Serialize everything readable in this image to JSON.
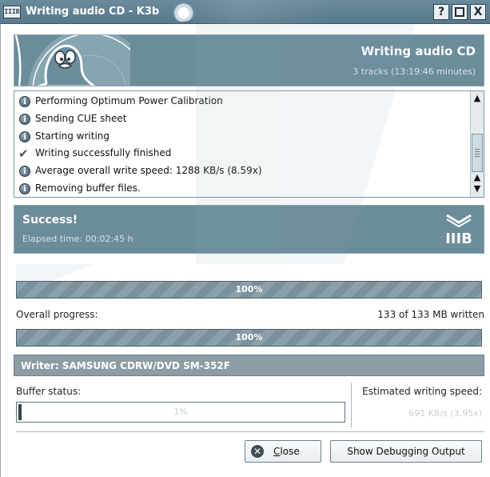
{
  "window": {
    "title": "Writing audio CD - K3b",
    "app_icon_text": "IIIB",
    "help_button": "?",
    "maximize_button": "□",
    "close_button": "X"
  },
  "header": {
    "title": "Writing audio CD",
    "subtitle": "3 tracks (13:19:46 minutes)"
  },
  "log": {
    "items": [
      {
        "icon": "info-icon",
        "text": "Performing Optimum Power Calibration"
      },
      {
        "icon": "info-icon",
        "text": "Sending CUE sheet"
      },
      {
        "icon": "info-icon",
        "text": "Starting writing"
      },
      {
        "icon": "check-icon",
        "text": "Writing successfully finished"
      },
      {
        "icon": "info-icon",
        "text": "Average overall write speed: 1288 KB/s (8.59x)"
      },
      {
        "icon": "info-icon",
        "text": "Removing buffer files."
      }
    ],
    "scroll_position": 0.55
  },
  "status": {
    "title": "Success!",
    "elapsed": "Elapsed time: 00:02:45 h",
    "logo_text": "IIIB"
  },
  "track_progress": {
    "label": "100%",
    "value": 1.0
  },
  "overall": {
    "label": "Overall progress:",
    "written": "133 of 133 MB written",
    "progress_label": "100%",
    "value": 1.0
  },
  "writer": {
    "label": "Writer: SAMSUNG CDRW/DVD SM-352F"
  },
  "buffer": {
    "label": "Buffer status:",
    "value_label": "1%",
    "value": 0.01
  },
  "speed": {
    "label": "Estimated writing speed:",
    "value": "691 KB/s (3.95x)"
  },
  "buttons": {
    "close_prefix": "",
    "close_mnemonic": "C",
    "close_rest": "lose",
    "debug": "Show Debugging Output"
  },
  "colors": {
    "accent": "#6b8c9b",
    "titlebar": "#56798c",
    "writer_bar": "#8c9ca4"
  }
}
